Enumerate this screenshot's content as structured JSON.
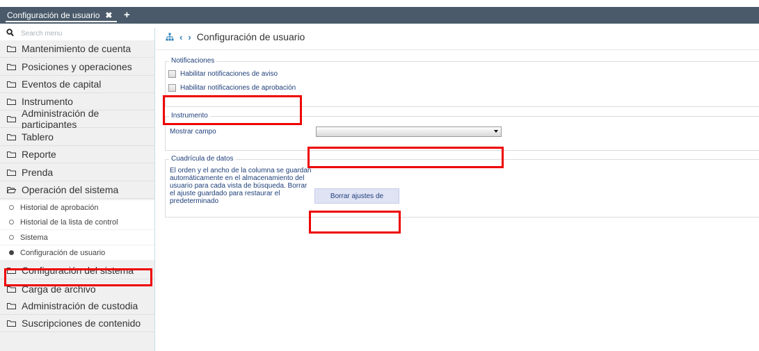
{
  "tabbar": {
    "tab_label": "Configuración de usuario",
    "close_glyph": "✖",
    "add_glyph": "+"
  },
  "sidebar": {
    "search_placeholder": "Search menu",
    "items": [
      {
        "label": "Mantenimiento de cuenta",
        "icon": "folder-closed-icon"
      },
      {
        "label": "Posiciones y operaciones",
        "icon": "folder-closed-icon"
      },
      {
        "label": "Eventos de capital",
        "icon": "folder-closed-icon"
      },
      {
        "label": "Instrumento",
        "icon": "folder-closed-icon"
      },
      {
        "label": "Administración de participantes",
        "icon": "folder-closed-icon"
      },
      {
        "label": "Tablero",
        "icon": "folder-closed-icon"
      },
      {
        "label": "Reporte",
        "icon": "folder-closed-icon"
      },
      {
        "label": "Prenda",
        "icon": "folder-closed-icon"
      },
      {
        "label": "Operación del sistema",
        "icon": "folder-open-icon"
      }
    ],
    "subitems": [
      {
        "label": "Historial de aprobación",
        "selected": false
      },
      {
        "label": "Historial de la lista de control",
        "selected": false
      },
      {
        "label": "Sistema",
        "selected": false
      },
      {
        "label": "Configuración de usuario",
        "selected": true
      }
    ],
    "items_after": [
      {
        "label": "Configuración del sistema",
        "icon": "folder-closed-icon"
      },
      {
        "label": "Carga de archivo",
        "icon": "folder-closed-icon"
      },
      {
        "label": "Administración de custodia",
        "icon": "folder-closed-icon"
      },
      {
        "label": "Suscripciones de contenido",
        "icon": "folder-closed-icon"
      }
    ]
  },
  "breadcrumb": {
    "title": "Configuración de usuario",
    "back_glyph": "‹",
    "forward_glyph": "›"
  },
  "notificaciones": {
    "legend": "Notificaciones",
    "aviso_label": "Habilitar notificaciones de aviso",
    "aprobacion_label": "Habilitar notificaciones de aprobación"
  },
  "instrumento": {
    "legend": "Instrumento",
    "field_label": "Mostrar campo",
    "selected_value": ""
  },
  "cuadricula": {
    "legend": "Cuadrícula de datos",
    "description": "El orden y el ancho de la columna se guardan automáticamente en el almacenamiento del usuario para cada vista de búsqueda. Borrar el ajuste guardado para restaurar el predeterminado",
    "button_label": "Borrar ajustes de"
  },
  "colors": {
    "accent": "#2a7fb8",
    "highlight": "#ee0000",
    "topbar": "#4a5a6a",
    "label_text": "#1f3f7a"
  }
}
